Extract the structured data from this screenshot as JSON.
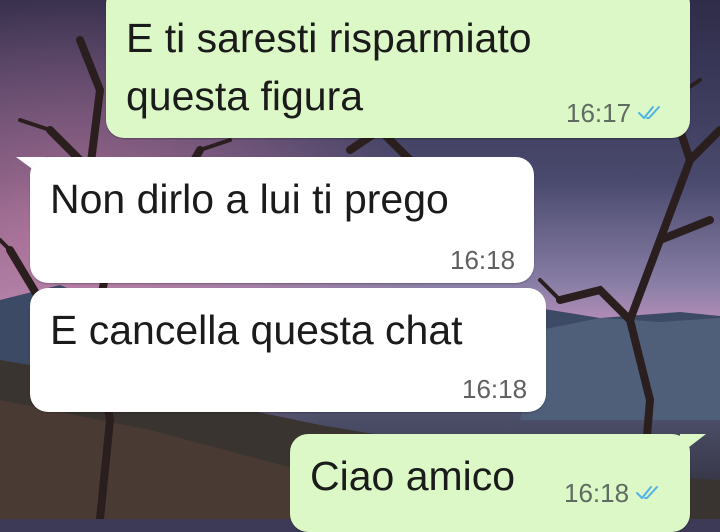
{
  "chat": {
    "messages": [
      {
        "direction": "outgoing",
        "text_lines": [
          "E ti saresti risparmiato",
          "questa figura"
        ],
        "time": "16:17",
        "status_icon": "double-check-read-icon"
      },
      {
        "direction": "incoming",
        "text_lines": [
          "Non dirlo a lui ti prego"
        ],
        "time": "16:18"
      },
      {
        "direction": "incoming",
        "text_lines": [
          "E cancella questa chat"
        ],
        "time": "16:18"
      },
      {
        "direction": "outgoing",
        "text_lines": [
          "Ciao amico"
        ],
        "time": "16:18",
        "status_icon": "double-check-read-icon"
      }
    ]
  },
  "colors": {
    "outgoing_bubble": "#dcf8c6",
    "incoming_bubble": "#ffffff",
    "read_ticks": "#4fb3e8",
    "timestamp": "#5f6b63"
  }
}
